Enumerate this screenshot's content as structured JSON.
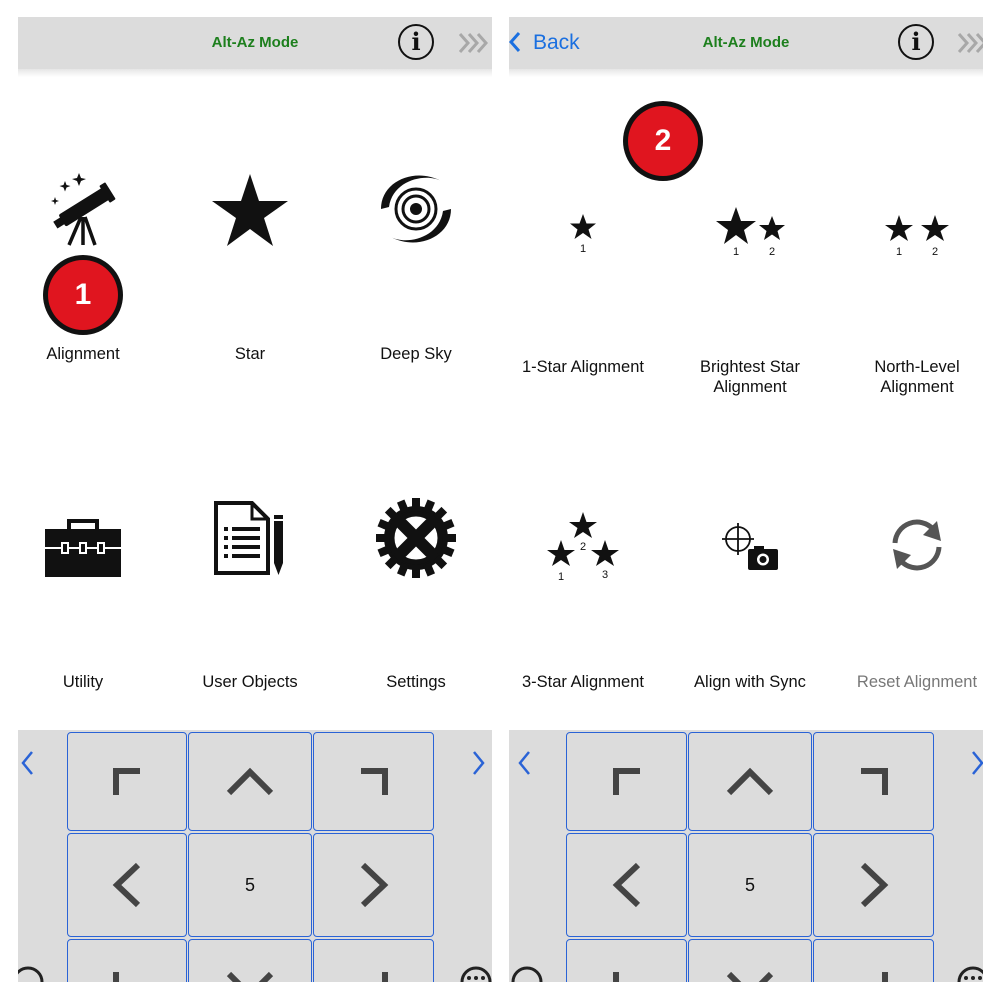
{
  "left_screen": {
    "title": "Alt-Az Mode",
    "info_icon": "info-icon",
    "more_icon": "chevrons-right-icon",
    "menu": [
      {
        "label": "Alignment",
        "icon": "telescope-icon"
      },
      {
        "label": "Star",
        "icon": "star-icon"
      },
      {
        "label": "Deep Sky",
        "icon": "galaxy-icon"
      },
      {
        "label": "Utility",
        "icon": "toolbox-icon"
      },
      {
        "label": "User Objects",
        "icon": "document-pencil-icon"
      },
      {
        "label": "Settings",
        "icon": "gear-icon"
      }
    ],
    "step_badge": "1",
    "keypad_center": "5"
  },
  "right_screen": {
    "back_label": "Back",
    "title": "Alt-Az Mode",
    "info_icon": "info-icon",
    "menu": [
      {
        "label": "1-Star Alignment",
        "icon": "one-star-icon",
        "star_numbers": [
          "1"
        ]
      },
      {
        "label_line1": "Brightest Star",
        "label_line2": "Alignment",
        "icon": "two-stars-icon",
        "star_numbers": [
          "1",
          "2"
        ]
      },
      {
        "label_line1": "North-Level",
        "label_line2": "Alignment",
        "icon": "two-small-stars-icon",
        "star_numbers": [
          "1",
          "2"
        ]
      },
      {
        "label": "3-Star Alignment",
        "icon": "three-stars-icon",
        "star_numbers": [
          "1",
          "2",
          "3"
        ]
      },
      {
        "label": "Align with Sync",
        "icon": "crosshair-camera-icon"
      },
      {
        "label": "Reset Alignment",
        "icon": "refresh-icon",
        "disabled": true
      }
    ],
    "step_badge": "2",
    "keypad_center": "5"
  },
  "colors": {
    "title_green": "#1d7f1d",
    "ios_blue": "#1a6fe0",
    "badge_red": "#e0151f",
    "keypad_bg": "#dcdcdc",
    "key_border": "#2a63d6"
  }
}
